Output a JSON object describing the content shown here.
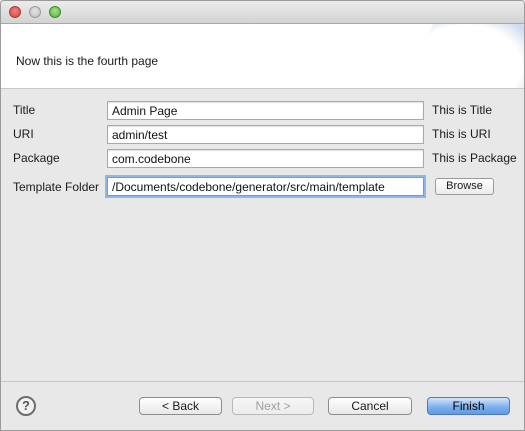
{
  "header": {
    "message": "Now this is the fourth page"
  },
  "form": {
    "rows": [
      {
        "label": "Title",
        "value": "Admin Page",
        "hint": "This is Title"
      },
      {
        "label": "URI",
        "value": "admin/test",
        "hint": "This is URI"
      },
      {
        "label": "Package",
        "value": "com.codebone",
        "hint": "This is Package"
      },
      {
        "label": "Template Folder",
        "value": "/Documents/codebone/generator/src/main/template",
        "hint": ""
      }
    ],
    "browse_label": "Browse"
  },
  "footer": {
    "help_glyph": "?",
    "back_label": "< Back",
    "next_label": "Next >",
    "cancel_label": "Cancel",
    "finish_label": "Finish"
  },
  "icons": {
    "help": "question-circle-icon"
  },
  "colors": {
    "finish_button": "#7fb1ee",
    "close_light": "#d8433a",
    "minimize_light": "#bcbcbc",
    "zoom_light": "#4fae3b"
  }
}
